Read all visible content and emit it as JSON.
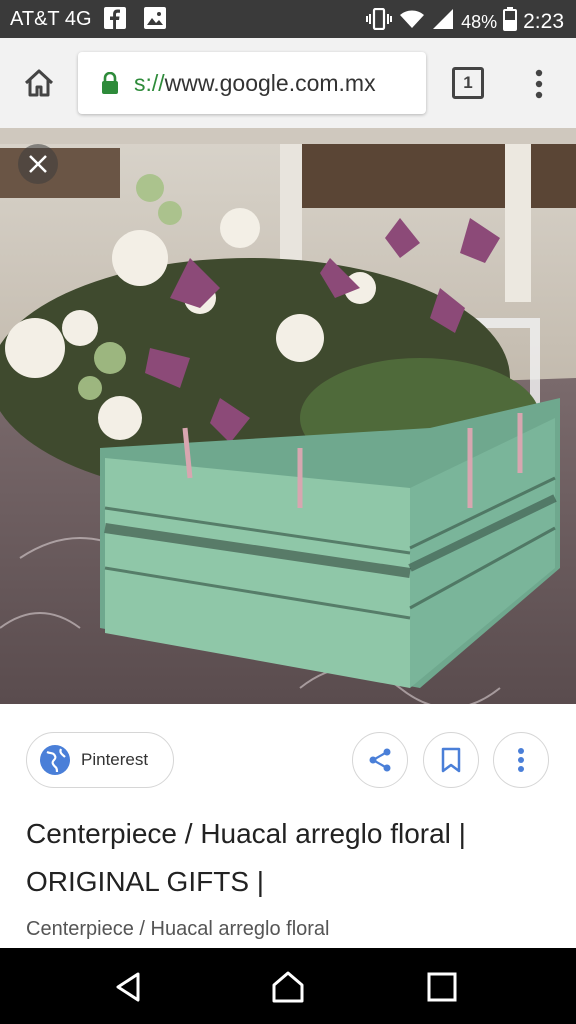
{
  "status_bar": {
    "carrier": "AT&T 4G",
    "battery": "48%",
    "time": "2:23",
    "icons": [
      "facebook-icon",
      "image-icon",
      "vibrate-icon",
      "wifi-icon",
      "signal-icon",
      "battery-icon"
    ]
  },
  "browser": {
    "url_scheme": "s://",
    "url_host": "www.google.com.mx",
    "tab_count": "1"
  },
  "image": {
    "alt": "Centerpiece / Huacal arreglo floral"
  },
  "result": {
    "source_label": "Pinterest",
    "title": "Centerpiece / Huacal arreglo floral | ORIGINAL GIFTS |",
    "subtitle": "Centerpiece / Huacal arreglo floral"
  },
  "colors": {
    "accent_blue": "#4a7fd8",
    "lock_green": "#2e8b3a",
    "crate_mint": "#8fc7a8"
  }
}
